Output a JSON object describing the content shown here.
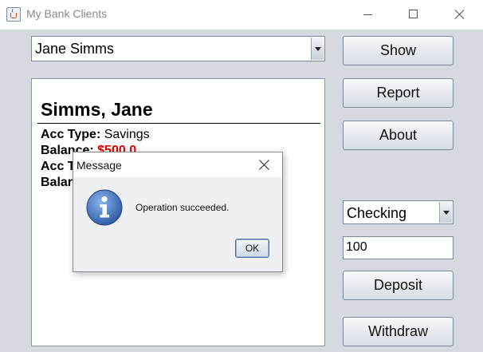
{
  "window": {
    "title": "My Bank Clients",
    "icon": "java-coffee-cup-icon"
  },
  "client_selector": {
    "selected": "Jane Simms"
  },
  "buttons": {
    "show": "Show",
    "report": "Report",
    "about": "About",
    "deposit": "Deposit",
    "withdraw": "Withdraw"
  },
  "account_selector": {
    "selected": "Checking"
  },
  "amount_field": {
    "value": "100"
  },
  "client_panel": {
    "name": "Simms, Jane",
    "lines": [
      {
        "label": "Acc Type:",
        "value": "Savings"
      },
      {
        "label": "Balance:",
        "value": "$500.0"
      },
      {
        "label": "Acc T",
        "value": ""
      },
      {
        "label": "Balar",
        "value": ""
      }
    ]
  },
  "dialog": {
    "title": "Message",
    "message": "Operation succeeded.",
    "ok_label": "OK",
    "icon": "info-icon"
  },
  "colors": {
    "window_bg": "#d6d9df",
    "money_red": "#e00000",
    "info_blue": "#2f5fa8"
  }
}
